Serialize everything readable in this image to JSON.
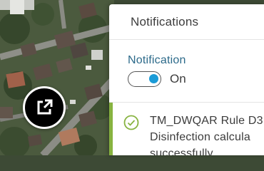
{
  "map": {
    "icon": "aerial-map-imagery"
  },
  "external_link": {
    "icon": "external-link-icon"
  },
  "panel": {
    "title": "Notifications",
    "setting_label": "Notification",
    "toggle_state": "On",
    "toggle_color": "#1a9bd7"
  },
  "notifications": [
    {
      "status_icon": "check-circle-icon",
      "status_color": "#87b340",
      "line1": "TM_DWQAR Rule D3",
      "line2": "Disinfection calcula",
      "line3": "successfully"
    }
  ]
}
